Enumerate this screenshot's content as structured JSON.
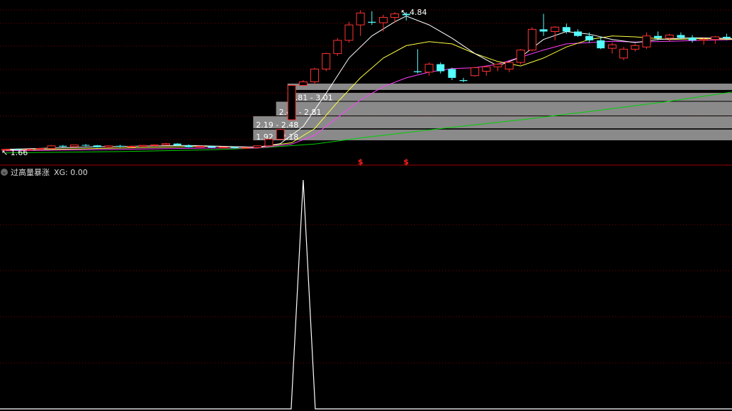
{
  "price_axis": {
    "min": 1.55,
    "max": 5.05
  },
  "top_labels": {
    "high_label": "4.84",
    "low_label": "1.66"
  },
  "chips": [
    {
      "label": "2.81 - 3.01",
      "low": 2.81,
      "high": 3.01,
      "start": 25
    },
    {
      "label": "2.48 - 2.81",
      "low": 2.48,
      "high": 2.81,
      "start": 24
    },
    {
      "label": "2.19 - 2.48",
      "low": 2.19,
      "high": 2.48,
      "start": 22
    },
    {
      "label": "1.92 - 2.18",
      "low": 1.92,
      "high": 2.18,
      "start": 22
    }
  ],
  "chip_top_bar": {
    "low": 3.06,
    "high": 3.22,
    "start": 25
  },
  "signals": [
    {
      "glyph": "$",
      "index": 31
    },
    {
      "glyph": "$",
      "index": 35
    }
  ],
  "candles": [
    [
      1.72,
      1.74,
      1.7,
      1.73
    ],
    [
      1.73,
      1.75,
      1.71,
      1.72
    ],
    [
      1.72,
      1.74,
      1.71,
      1.73
    ],
    [
      1.73,
      1.76,
      1.72,
      1.75
    ],
    [
      1.75,
      1.83,
      1.74,
      1.81
    ],
    [
      1.81,
      1.83,
      1.78,
      1.79
    ],
    [
      1.79,
      1.84,
      1.78,
      1.83
    ],
    [
      1.83,
      1.85,
      1.8,
      1.82
    ],
    [
      1.82,
      1.83,
      1.77,
      1.78
    ],
    [
      1.78,
      1.82,
      1.77,
      1.81
    ],
    [
      1.81,
      1.83,
      1.78,
      1.79
    ],
    [
      1.79,
      1.82,
      1.78,
      1.8
    ],
    [
      1.8,
      1.83,
      1.79,
      1.82
    ],
    [
      1.82,
      1.84,
      1.8,
      1.83
    ],
    [
      1.83,
      1.88,
      1.82,
      1.86
    ],
    [
      1.86,
      1.87,
      1.81,
      1.82
    ],
    [
      1.82,
      1.84,
      1.77,
      1.78
    ],
    [
      1.78,
      1.81,
      1.77,
      1.8
    ],
    [
      1.8,
      1.81,
      1.76,
      1.77
    ],
    [
      1.77,
      1.79,
      1.75,
      1.78
    ],
    [
      1.78,
      1.8,
      1.75,
      1.76
    ],
    [
      1.76,
      1.78,
      1.74,
      1.77
    ],
    [
      1.77,
      1.82,
      1.76,
      1.81
    ],
    [
      1.81,
      1.97,
      1.8,
      1.96
    ],
    [
      1.96,
      2.19,
      1.95,
      2.18
    ],
    [
      2.4,
      3.2,
      2.38,
      3.18
    ],
    [
      3.18,
      3.3,
      3.16,
      3.26
    ],
    [
      3.26,
      3.58,
      3.2,
      3.55
    ],
    [
      3.55,
      3.92,
      3.5,
      3.9
    ],
    [
      3.9,
      4.25,
      3.85,
      4.2
    ],
    [
      4.2,
      4.62,
      4.15,
      4.55
    ],
    [
      4.55,
      4.88,
      4.3,
      4.82
    ],
    [
      4.62,
      4.86,
      4.55,
      4.6
    ],
    [
      4.6,
      4.78,
      4.4,
      4.72
    ],
    [
      4.72,
      4.84,
      4.6,
      4.8
    ],
    [
      4.8,
      4.84,
      4.65,
      4.77
    ],
    [
      3.5,
      4.0,
      3.45,
      3.48
    ],
    [
      3.48,
      3.7,
      3.4,
      3.66
    ],
    [
      3.66,
      3.7,
      3.45,
      3.5
    ],
    [
      3.55,
      3.58,
      3.3,
      3.35
    ],
    [
      3.3,
      3.35,
      3.25,
      3.28
    ],
    [
      3.4,
      3.6,
      3.38,
      3.58
    ],
    [
      3.5,
      3.62,
      3.4,
      3.6
    ],
    [
      3.6,
      3.68,
      3.5,
      3.66
    ],
    [
      3.55,
      3.72,
      3.48,
      3.7
    ],
    [
      3.7,
      4.0,
      3.65,
      3.98
    ],
    [
      3.98,
      4.5,
      3.95,
      4.45
    ],
    [
      4.45,
      4.8,
      4.3,
      4.4
    ],
    [
      4.4,
      4.52,
      4.2,
      4.5
    ],
    [
      4.5,
      4.58,
      4.35,
      4.4
    ],
    [
      4.4,
      4.45,
      4.28,
      4.3
    ],
    [
      4.3,
      4.38,
      4.15,
      4.2
    ],
    [
      4.2,
      4.28,
      4.0,
      4.02
    ],
    [
      4.02,
      4.15,
      3.9,
      4.1
    ],
    [
      3.8,
      4.05,
      3.75,
      4.0
    ],
    [
      4.0,
      4.12,
      3.95,
      4.08
    ],
    [
      4.05,
      4.38,
      4.0,
      4.3
    ],
    [
      4.3,
      4.4,
      4.2,
      4.25
    ],
    [
      4.25,
      4.35,
      4.18,
      4.32
    ],
    [
      4.32,
      4.38,
      4.22,
      4.26
    ],
    [
      4.26,
      4.32,
      4.15,
      4.2
    ],
    [
      4.2,
      4.28,
      4.1,
      4.22
    ],
    [
      4.22,
      4.3,
      4.12,
      4.28
    ],
    [
      4.28,
      4.35,
      4.2,
      4.25
    ],
    [
      4.25,
      4.3,
      4.1,
      4.12
    ]
  ],
  "ma": {
    "white": [
      [
        0,
        1.73
      ],
      [
        8,
        1.79
      ],
      [
        16,
        1.82
      ],
      [
        22,
        1.78
      ],
      [
        24,
        1.86
      ],
      [
        26,
        2.25
      ],
      [
        28,
        3.0
      ],
      [
        30,
        3.8
      ],
      [
        32,
        4.3
      ],
      [
        34,
        4.62
      ],
      [
        35,
        4.75
      ],
      [
        37,
        4.55
      ],
      [
        39,
        4.25
      ],
      [
        41,
        3.9
      ],
      [
        43,
        3.62
      ],
      [
        45,
        3.82
      ],
      [
        47,
        4.22
      ],
      [
        49,
        4.4
      ],
      [
        51,
        4.34
      ],
      [
        53,
        4.22
      ],
      [
        55,
        4.15
      ],
      [
        57,
        4.22
      ],
      [
        60,
        4.26
      ],
      [
        64,
        4.24
      ]
    ],
    "yellow": [
      [
        0,
        1.71
      ],
      [
        10,
        1.76
      ],
      [
        18,
        1.8
      ],
      [
        22,
        1.78
      ],
      [
        25,
        1.88
      ],
      [
        27,
        2.2
      ],
      [
        29,
        2.8
      ],
      [
        31,
        3.35
      ],
      [
        33,
        3.8
      ],
      [
        35,
        4.08
      ],
      [
        37,
        4.17
      ],
      [
        39,
        4.12
      ],
      [
        41,
        3.9
      ],
      [
        43,
        3.72
      ],
      [
        45,
        3.62
      ],
      [
        47,
        3.8
      ],
      [
        49,
        4.05
      ],
      [
        51,
        4.22
      ],
      [
        53,
        4.3
      ],
      [
        55,
        4.28
      ],
      [
        58,
        4.22
      ],
      [
        61,
        4.24
      ],
      [
        64,
        4.22
      ]
    ],
    "magenta": [
      [
        0,
        1.7
      ],
      [
        10,
        1.73
      ],
      [
        18,
        1.76
      ],
      [
        22,
        1.76
      ],
      [
        25,
        1.85
      ],
      [
        27,
        2.05
      ],
      [
        29,
        2.45
      ],
      [
        31,
        2.85
      ],
      [
        33,
        3.15
      ],
      [
        35,
        3.35
      ],
      [
        37,
        3.48
      ],
      [
        39,
        3.56
      ],
      [
        41,
        3.58
      ],
      [
        43,
        3.66
      ],
      [
        45,
        3.82
      ],
      [
        47,
        3.98
      ],
      [
        49,
        4.12
      ],
      [
        51,
        4.15
      ],
      [
        53,
        4.18
      ],
      [
        55,
        4.16
      ],
      [
        58,
        4.18
      ],
      [
        61,
        4.2
      ],
      [
        64,
        4.22
      ]
    ],
    "green": [
      [
        0,
        1.65
      ],
      [
        10,
        1.68
      ],
      [
        18,
        1.72
      ],
      [
        22,
        1.76
      ],
      [
        27,
        1.85
      ],
      [
        32,
        2.02
      ],
      [
        38,
        2.2
      ],
      [
        45,
        2.4
      ],
      [
        52,
        2.62
      ],
      [
        58,
        2.82
      ],
      [
        64,
        3.05
      ]
    ]
  },
  "indicator": {
    "name": "过高量暴涨",
    "xg_text": "XG: 0.00",
    "spike_index": 26
  },
  "colors": {
    "up": "#ff3232",
    "down": "#54ffff",
    "ma_white": "#ffffff",
    "ma_yellow": "#ffff40",
    "ma_magenta": "#ff40ff",
    "ma_green": "#00d000",
    "chip": "#8a8a8a",
    "grid": "#7a0000",
    "signal": "#ff2020"
  }
}
